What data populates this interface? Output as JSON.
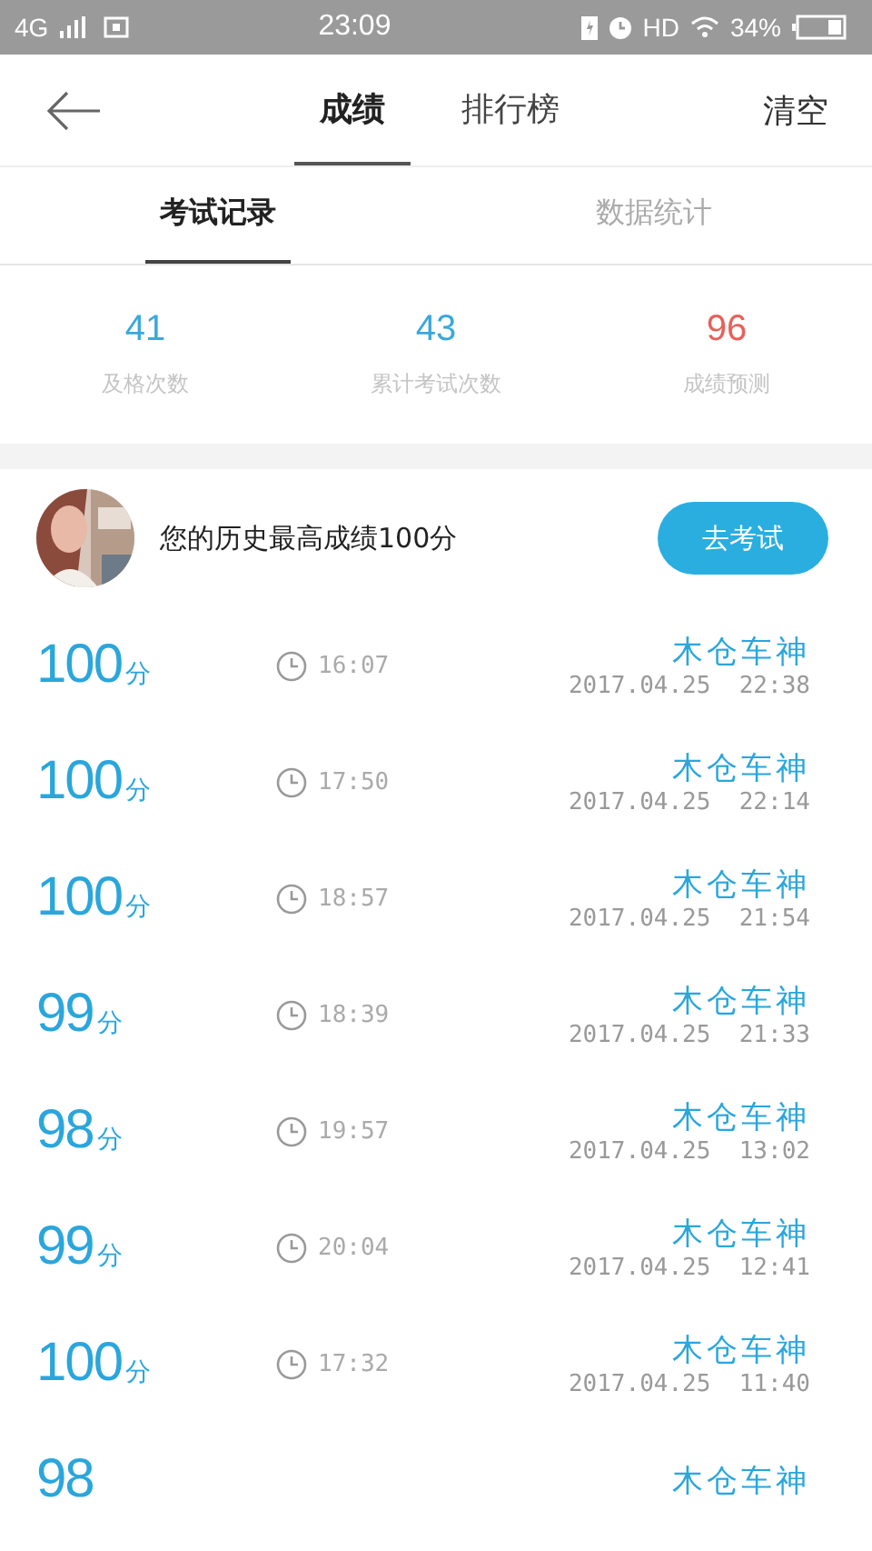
{
  "status_bar": {
    "network": "4G",
    "time": "23:09",
    "hd": "HD",
    "battery": "34%"
  },
  "nav": {
    "tabs": [
      {
        "label": "成绩",
        "selected": true
      },
      {
        "label": "排行榜",
        "selected": false
      }
    ],
    "action": "清空"
  },
  "subtabs": [
    {
      "label": "考试记录",
      "selected": true
    },
    {
      "label": "数据统计",
      "selected": false
    }
  ],
  "stats": [
    {
      "value": "41",
      "label": "及格次数",
      "color": "#3aa8dc"
    },
    {
      "value": "43",
      "label": "累计考试次数",
      "color": "#3aa8dc"
    },
    {
      "value": "96",
      "label": "成绩预测",
      "color": "#e8605a"
    }
  ],
  "best": {
    "text": "您的历史最高成绩100分",
    "button": "去考试"
  },
  "records": [
    {
      "score": "100",
      "unit": "分",
      "duration": "16:07",
      "name": "木仓车神",
      "date": "2017.04.25  22:38"
    },
    {
      "score": "100",
      "unit": "分",
      "duration": "17:50",
      "name": "木仓车神",
      "date": "2017.04.25  22:14"
    },
    {
      "score": "100",
      "unit": "分",
      "duration": "18:57",
      "name": "木仓车神",
      "date": "2017.04.25  21:54"
    },
    {
      "score": "99",
      "unit": "分",
      "duration": "18:39",
      "name": "木仓车神",
      "date": "2017.04.25  21:33"
    },
    {
      "score": "98",
      "unit": "分",
      "duration": "19:57",
      "name": "木仓车神",
      "date": "2017.04.25  13:02"
    },
    {
      "score": "99",
      "unit": "分",
      "duration": "20:04",
      "name": "木仓车神",
      "date": "2017.04.25  12:41"
    },
    {
      "score": "100",
      "unit": "分",
      "duration": "17:32",
      "name": "木仓车神",
      "date": "2017.04.25  11:40"
    },
    {
      "score": "98",
      "name": "木仓车神"
    }
  ]
}
